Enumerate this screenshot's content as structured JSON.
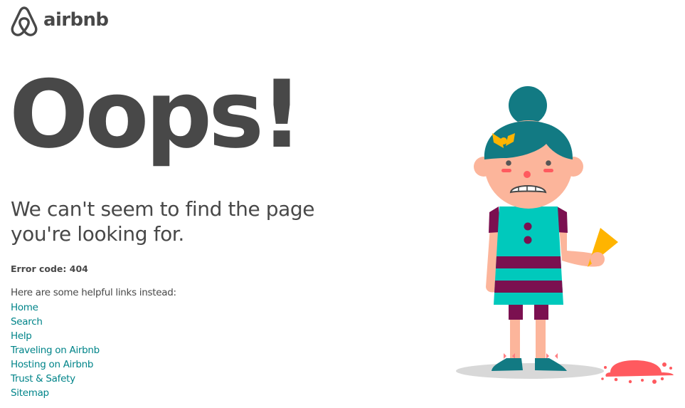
{
  "brand": {
    "name": "airbnb",
    "logo_icon": "belo-icon",
    "color": "#484848"
  },
  "main": {
    "headline": "Oops!",
    "subheading": "We can't seem to find the page you're looking for.",
    "error_code": "Error code: 404",
    "helpful_intro": "Here are some helpful links instead:",
    "links": [
      {
        "label": "Home"
      },
      {
        "label": "Search"
      },
      {
        "label": "Help"
      },
      {
        "label": "Traveling on Airbnb"
      },
      {
        "label": "Hosting on Airbnb"
      },
      {
        "label": "Trust & Safety"
      },
      {
        "label": "Sitemap"
      }
    ]
  },
  "illustration": {
    "description_icon": "sad-girl-dropped-ice-cream-illustration"
  },
  "colors": {
    "text": "#484848",
    "link": "#008489",
    "teal_hair": "#127a83",
    "dress": "#00c9bc",
    "stripe": "#7b1050",
    "skin": "#fcb59b",
    "cone": "#ffb400",
    "ice_cream": "#ff5a5f"
  }
}
